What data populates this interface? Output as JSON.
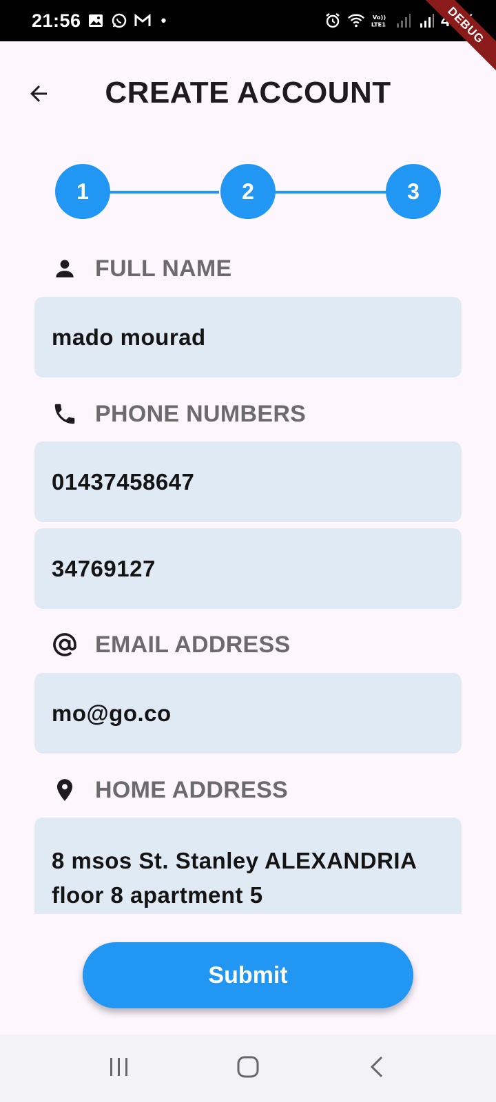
{
  "status_bar": {
    "time": "21:56",
    "battery": "47%",
    "icons": [
      "gallery-icon",
      "whatsapp-icon",
      "gmail-icon",
      "alarm-icon",
      "wifi-icon",
      "volte-icon",
      "signal-icon",
      "signal-icon-2"
    ],
    "notification_dot": "•"
  },
  "debug_banner": "DEBUG",
  "header": {
    "title": "CREATE ACCOUNT",
    "back_icon": "arrow-left-icon"
  },
  "stepper": {
    "steps": [
      "1",
      "2",
      "3"
    ],
    "color": "#2196f3"
  },
  "form": {
    "full_name": {
      "label": "FULL NAME",
      "icon": "person-icon",
      "value": "mado mourad"
    },
    "phone_numbers": {
      "label": "PHONE NUMBERS",
      "icon": "phone-icon",
      "values": [
        "01437458647",
        "34769127"
      ]
    },
    "email": {
      "label": "EMAIL ADDRESS",
      "icon": "at-icon",
      "value": "mo@go.co"
    },
    "home_address": {
      "label": "HOME ADDRESS",
      "icon": "location-pin-icon",
      "value": "8 msos St. Stanley ALEXANDRIA floor 8 apartment 5"
    }
  },
  "submit_label": "Submit",
  "nav_bar": {
    "buttons": [
      "recent-apps-icon",
      "home-icon",
      "back-icon"
    ]
  },
  "colors": {
    "primary": "#2196f3",
    "field_background": "#e0eaf5",
    "page_background": "#fdf6fd",
    "label_gray": "#6b6b6b"
  }
}
